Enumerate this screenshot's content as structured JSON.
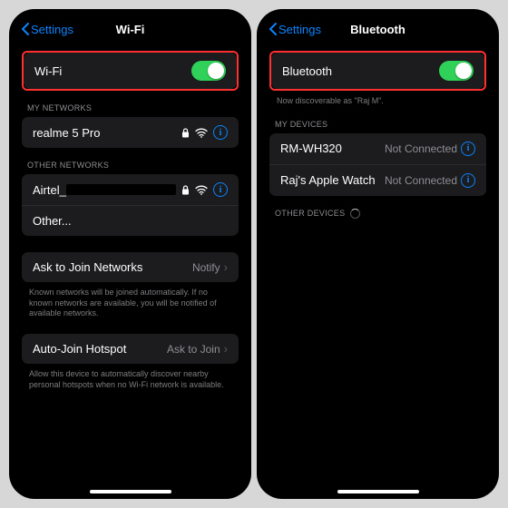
{
  "back_label": "Settings",
  "wifi": {
    "title": "Wi-Fi",
    "toggle_label": "Wi-Fi",
    "my_networks_header": "My Networks",
    "my_network": "realme 5 Pro",
    "other_networks_header": "Other Networks",
    "other_network_1": "Airtel_",
    "other_label": "Other...",
    "ask_join_label": "Ask to Join Networks",
    "ask_join_value": "Notify",
    "ask_join_foot": "Known networks will be joined automatically. If no known networks are available, you will be notified of available networks.",
    "hotspot_label": "Auto-Join Hotspot",
    "hotspot_value": "Ask to Join",
    "hotspot_foot": "Allow this device to automatically discover nearby personal hotspots when no Wi-Fi network is available."
  },
  "bt": {
    "title": "Bluetooth",
    "toggle_label": "Bluetooth",
    "discoverable": "Now discoverable as \"Raj M\".",
    "my_devices_header": "My Devices",
    "dev1_name": "RM-WH320",
    "dev1_status": "Not Connected",
    "dev2_name": "Raj's Apple Watch",
    "dev2_status": "Not Connected",
    "other_devices_header": "Other Devices"
  }
}
